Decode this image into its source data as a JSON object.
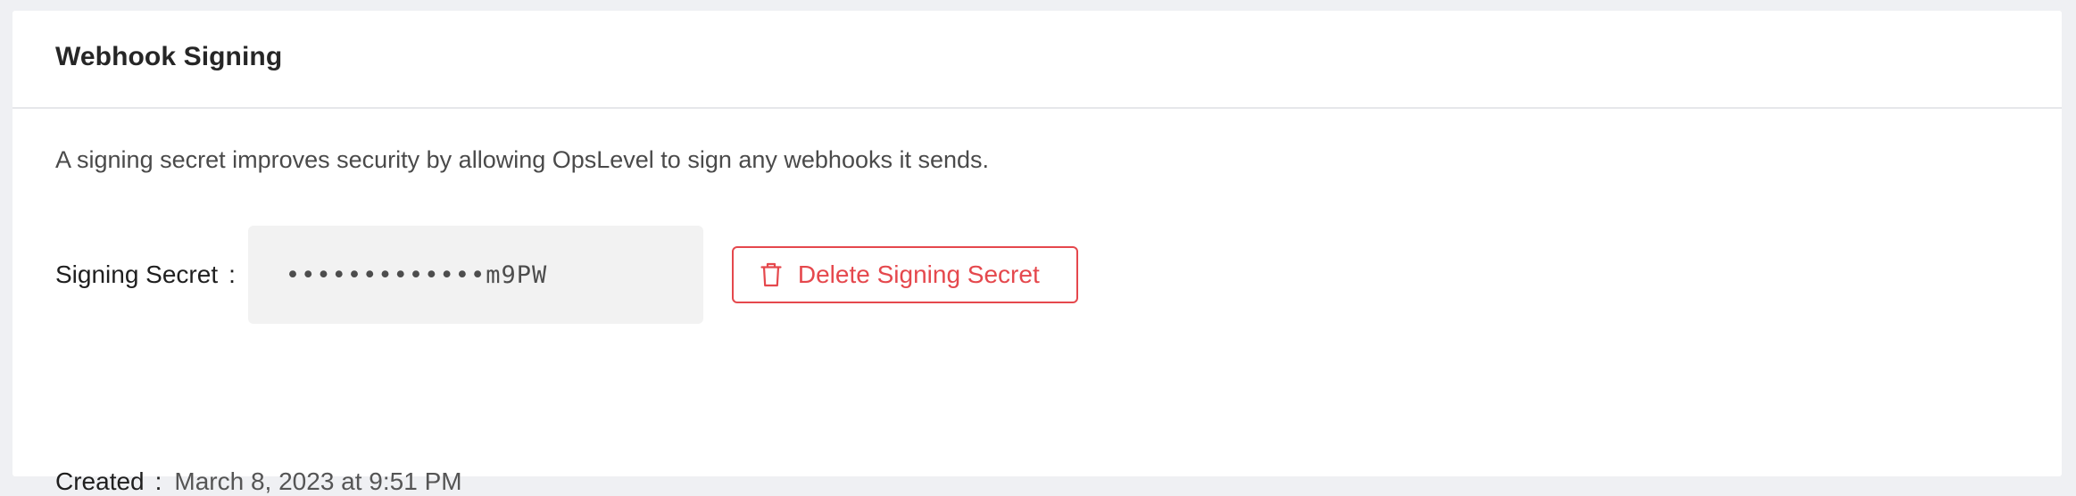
{
  "section": {
    "title": "Webhook Signing",
    "description": "A signing secret improves security by allowing OpsLevel to sign any webhooks it sends."
  },
  "secret": {
    "label": "Signing Secret",
    "colon": ":",
    "masked_value": "•••••••••••••m9PW"
  },
  "delete_button": {
    "label": "Delete Signing Secret",
    "icon": "trash-icon",
    "color": "#e5484d"
  },
  "created": {
    "label": "Created",
    "colon": ":",
    "value": "March 8, 2023 at 9:51 PM"
  }
}
